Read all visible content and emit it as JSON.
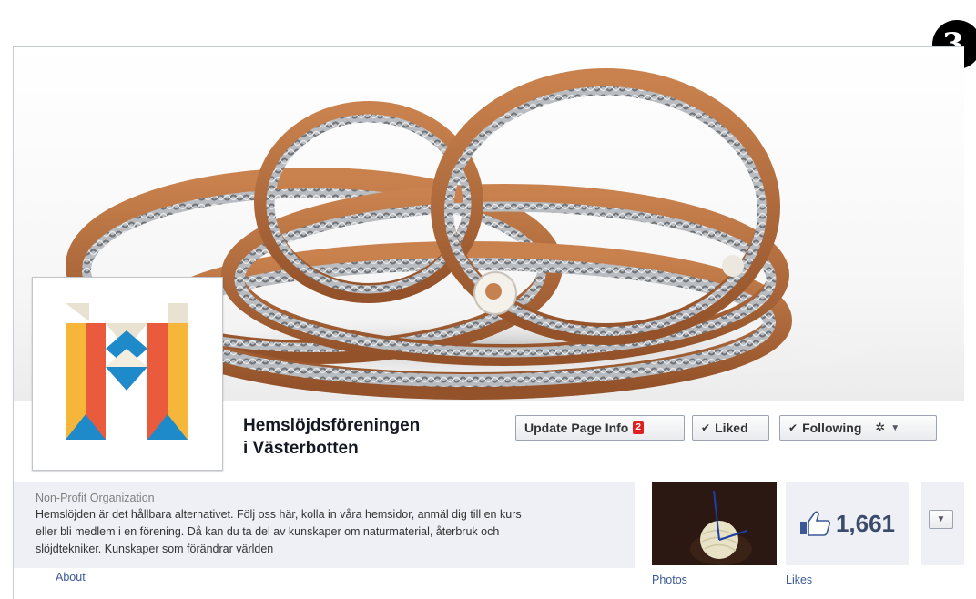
{
  "step_badge": "3",
  "page": {
    "name_line1": "Hemslöjdsföreningen",
    "name_line2": "i Västerbotten"
  },
  "actions": {
    "update_label": "Update Page Info",
    "update_badge": "2",
    "liked_label": "Liked",
    "following_label": "Following"
  },
  "info": {
    "category": "Non-Profit Organization",
    "description_lines": [
      "Hemslöjden är det hållbara alternativet. Följ oss här, kolla in våra hemsidor, anmäl dig till en kurs",
      "eller bli medlem i en förening. Då kan du ta del av kunskaper om naturmaterial, återbruk och",
      "slöjdtekniker. Kunskaper som förändrar världen"
    ],
    "about_label": "About"
  },
  "apps": {
    "photos_label": "Photos",
    "likes_count": "1,661",
    "likes_label": "Likes"
  },
  "icons": {
    "check": "check-icon",
    "gear": "gear-icon",
    "dropdown": "chevron-down-icon",
    "thumb": "thumbs-up-icon"
  }
}
